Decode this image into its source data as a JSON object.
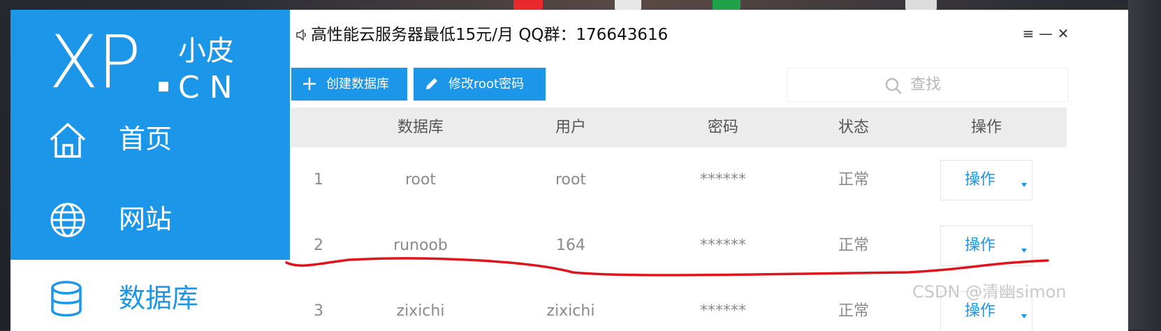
{
  "app": {
    "logo": {
      "mark": "XP",
      "chinese": "小皮",
      "english": "CN"
    },
    "title": "高性能云服务器最低15元/月  QQ群：176643616",
    "window_controls": {
      "menu": "≡",
      "minimize": "—",
      "close": "✕"
    }
  },
  "sidebar": {
    "items": [
      {
        "label": "首页",
        "icon": "home-icon"
      },
      {
        "label": "网站",
        "icon": "globe-icon"
      },
      {
        "label": "数据库",
        "icon": "database-icon",
        "active": true
      }
    ]
  },
  "toolbar": {
    "create_label": "创建数据库",
    "create_icon": "plus-icon",
    "modify_label": "修改root密码",
    "modify_icon": "pencil-icon",
    "search_placeholder": "查找",
    "search_icon": "search-icon"
  },
  "table": {
    "headers": [
      "数据库",
      "用户",
      "密码",
      "状态",
      "操作"
    ],
    "rows": [
      {
        "index": "1",
        "database": "root",
        "user": "root",
        "password": "******",
        "status": "正常",
        "action": "操作"
      },
      {
        "index": "2",
        "database": "runoob",
        "user": "164",
        "password": "******",
        "status": "正常",
        "action": "操作"
      },
      {
        "index": "3",
        "database": "zixichi",
        "user": "zixichi",
        "password": "******",
        "status": "正常",
        "action": "操作"
      }
    ]
  },
  "watermark": "CSDN @清幽simon",
  "colors": {
    "accent": "#1b96e8",
    "annotation": "#e0151b",
    "header_bg": "#ececec"
  }
}
